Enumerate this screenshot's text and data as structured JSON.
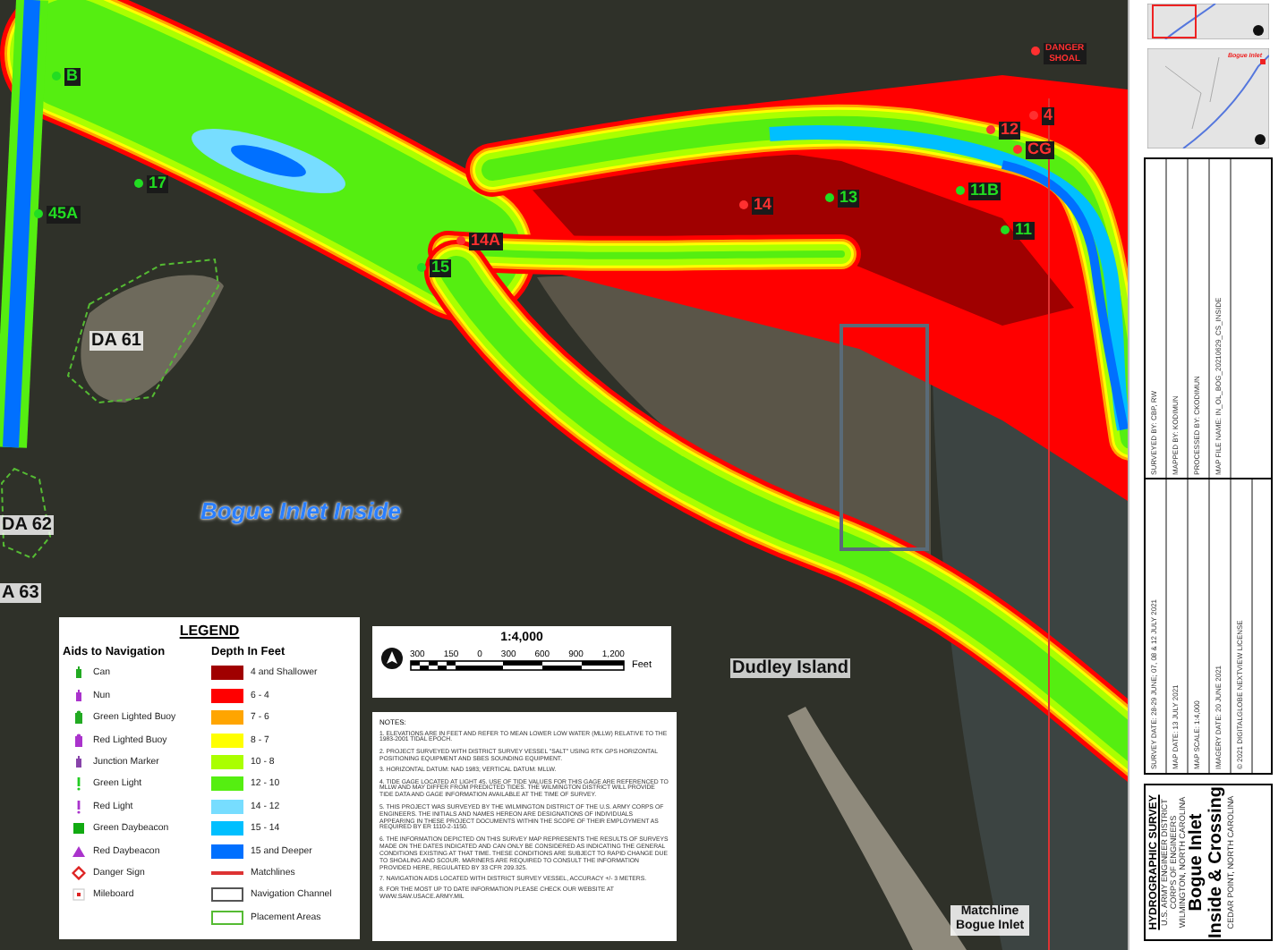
{
  "map": {
    "markers": [
      {
        "text": "DANGER SHOAL",
        "color": "#ff3030"
      },
      {
        "text": "B",
        "color": "#22dd22"
      },
      {
        "text": "4",
        "color": "#ff3030"
      },
      {
        "text": "12",
        "color": "#ff3030"
      },
      {
        "text": "CG",
        "color": "#ff3030"
      },
      {
        "text": "17",
        "color": "#22dd22"
      },
      {
        "text": "11B",
        "color": "#22dd22"
      },
      {
        "text": "13",
        "color": "#22dd22"
      },
      {
        "text": "14",
        "color": "#ff3030"
      },
      {
        "text": "45A",
        "color": "#22dd22"
      },
      {
        "text": "11",
        "color": "#22dd22"
      },
      {
        "text": "14A",
        "color": "#ff3030"
      },
      {
        "text": "15",
        "color": "#22dd22"
      }
    ],
    "places": [
      {
        "text": "DA 61",
        "kind": "area"
      },
      {
        "text": "DA 62",
        "kind": "area"
      },
      {
        "text": "A 63",
        "kind": "area"
      },
      {
        "text": "Bogue Inlet Inside",
        "kind": "water"
      },
      {
        "text": "Dudley Island",
        "kind": "land"
      },
      {
        "text": "Matchline Bogue Inlet",
        "kind": "matchline"
      }
    ]
  },
  "legend": {
    "title": "LEGEND",
    "aids_heading": "Aids to Navigation",
    "depth_heading": "Depth In Feet",
    "aids": [
      {
        "label": "Can",
        "kind": "can"
      },
      {
        "label": "Nun",
        "kind": "nun"
      },
      {
        "label": "Green Lighted Buoy",
        "kind": "green-lighted-buoy"
      },
      {
        "label": "Red Lighted Buoy",
        "kind": "red-lighted-buoy"
      },
      {
        "label": "Junction Marker",
        "kind": "junction"
      },
      {
        "label": "Green Light",
        "kind": "green-light"
      },
      {
        "label": "Red Light",
        "kind": "red-light"
      },
      {
        "label": "Green Daybeacon",
        "kind": "green-daybeacon"
      },
      {
        "label": "Red Daybeacon",
        "kind": "red-daybeacon"
      },
      {
        "label": "Danger Sign",
        "kind": "danger"
      },
      {
        "label": "Mileboard",
        "kind": "mileboard"
      }
    ],
    "depths": [
      {
        "label": "4 and Shallower",
        "kind": "fill",
        "color": "#a00000"
      },
      {
        "label": "6 - 4",
        "kind": "fill",
        "color": "#ff0000"
      },
      {
        "label": "7 - 6",
        "kind": "fill",
        "color": "#ffa500"
      },
      {
        "label": "8 - 7",
        "kind": "fill",
        "color": "#ffff00"
      },
      {
        "label": "10 - 8",
        "kind": "fill",
        "color": "#aaff00"
      },
      {
        "label": "12 - 10",
        "kind": "fill",
        "color": "#55ee11"
      },
      {
        "label": "14 - 12",
        "kind": "fill",
        "color": "#77ddff"
      },
      {
        "label": "15 - 14",
        "kind": "fill",
        "color": "#00bfff"
      },
      {
        "label": "15 and Deeper",
        "kind": "fill",
        "color": "#0070ff"
      },
      {
        "label": "Matchlines",
        "kind": "line",
        "color": "#dd3333"
      },
      {
        "label": "Navigation Channel",
        "kind": "outline",
        "color": "#555555"
      },
      {
        "label": "Placement Areas",
        "kind": "outline",
        "color": "#55bb33"
      }
    ]
  },
  "scale": {
    "ratio": "1:4,000",
    "ticks": [
      "300",
      "150",
      "0",
      "300",
      "600",
      "900",
      "1,200"
    ],
    "unit": "Feet"
  },
  "notes": {
    "heading": "NOTES:",
    "items": [
      "1. ELEVATIONS ARE IN FEET AND REFER TO MEAN LOWER LOW WATER (MLLW) RELATIVE TO THE 1983-2001 TIDAL EPOCH.",
      "2. PROJECT SURVEYED WITH DISTRICT SURVEY VESSEL \"SALT\" USING RTK GPS HORIZONTAL POSITIONING EQUIPMENT AND SBES SOUNDING EQUIPMENT.",
      "3. HORIZONTAL DATUM: NAD 1983; VERTICAL DATUM: MLLW.",
      "4. TIDE GAGE LOCATED AT LIGHT 45. USE OF TIDE VALUES FOR THIS GAGE ARE REFERENCED TO MLLW AND MAY DIFFER FROM PREDICTED TIDES. THE WILMINGTON DISTRICT WILL PROVIDE TIDE DATA AND GAGE INFORMATION AVAILABLE AT THE TIME OF SURVEY.",
      "5. THIS PROJECT WAS SURVEYED BY THE WILMINGTON DISTRICT OF THE U.S. ARMY CORPS OF ENGINEERS. THE INITIALS AND NAMES HEREON ARE DESIGNATIONS OF INDIVIDUALS APPEARING IN THESE PROJECT DOCUMENTS WITHIN THE SCOPE OF THEIR EMPLOYMENT AS REQUIRED BY ER 1110-2-1150.",
      "6. THE INFORMATION DEPICTED ON THIS SURVEY MAP REPRESENTS THE RESULTS OF SURVEYS MADE ON THE DATES INDICATED AND CAN ONLY BE CONSIDERED AS INDICATING THE GENERAL CONDITIONS EXISTING AT THAT TIME. THESE CONDITIONS ARE SUBJECT TO RAPID CHANGE DUE TO SHOALING AND SCOUR. MARINERS ARE REQUIRED TO CONSULT THE INFORMATION PROVIDED HERE, REGULATED BY 33 CFR 209.325.",
      "7. NAVIGATION AIDS LOCATED WITH DISTRICT SURVEY VESSEL, ACCURACY +/- 3 METERS.",
      "8. FOR THE MOST UP TO DATE INFORMATION PLEASE CHECK OUR WEBSITE AT WWW.SAW.USACE.ARMY.MIL"
    ]
  },
  "sidebar": {
    "inset_label": "Bogue Inlet",
    "info_left": [
      "SURVEY DATE: 28-29 JUNE; 07, 08 & 12 JULY 2021",
      "MAP DATE: 13 JULY 2021",
      "MAP SCALE: 1:4,000",
      "IMAGERY DATE: 20 JUNE 2021",
      "© 2021 DIGITALGLOBE NEXTVIEW LICENSE"
    ],
    "info_right": [
      "SURVEYED BY: CBP, RW",
      "MAPPED BY: KODIMUN",
      "PROCESSED BY: CKODIMUN",
      "MAP FILE NAME: IN_OL_BOG_20210629_CS_INSIDE"
    ],
    "title_block": {
      "heading": "HYDROGRAPHIC SURVEY",
      "agency": [
        "U.S. ARMY ENGINEER DISTRICT",
        "CORPS OF ENGINEERS",
        "WILMINGTON, NORTH CAROLINA"
      ],
      "title": [
        "Bogue Inlet",
        "Inside & Crossing"
      ],
      "location": "CEDAR POINT, NORTH CAROLINA"
    }
  }
}
